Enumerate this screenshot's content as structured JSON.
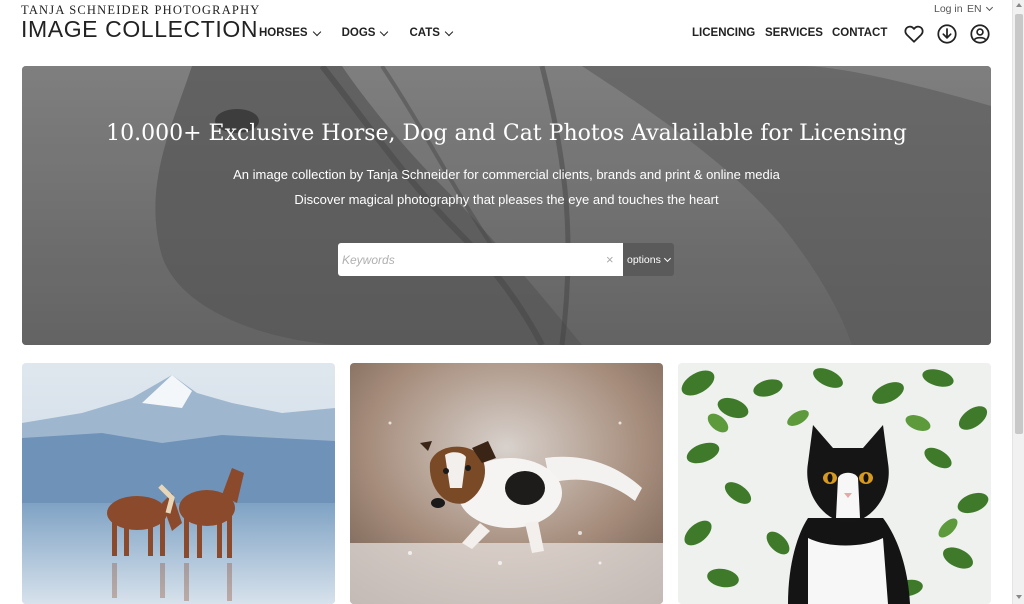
{
  "header": {
    "brand_top": "TANJA SCHNEIDER PHOTOGRAPHY",
    "brand_main": "IMAGE COLLECTION",
    "nav_left": [
      {
        "label": "HORSES"
      },
      {
        "label": "DOGS"
      },
      {
        "label": "CATS"
      }
    ],
    "nav_right": {
      "licencing": "LICENCING",
      "services": "SERVICES",
      "contact": "CONTACT"
    },
    "login": "Log in",
    "language": "EN",
    "icons": [
      "heart-icon",
      "download-icon",
      "user-icon"
    ]
  },
  "hero": {
    "title": "10.000+ Exclusive Horse, Dog and Cat Photos Avalailable for Licensing",
    "subtitle_1": "An image collection by Tanja Schneider for commercial clients, brands and print & online media",
    "subtitle_2": "Discover magical photography that pleases the eye and touches the heart",
    "search_placeholder": "Keywords",
    "clear_symbol": "×",
    "options_label": "options"
  },
  "cards": [
    {
      "subject": "two horses standing in water with snowy mountains"
    },
    {
      "subject": "jack russell terrier leaping through snow"
    },
    {
      "subject": "black and white kitten among green leaves"
    }
  ],
  "colors": {
    "text": "#222222",
    "hero_overlay": "#7a7a7a",
    "options_bg": "#5a5a5a",
    "white": "#ffffff"
  }
}
